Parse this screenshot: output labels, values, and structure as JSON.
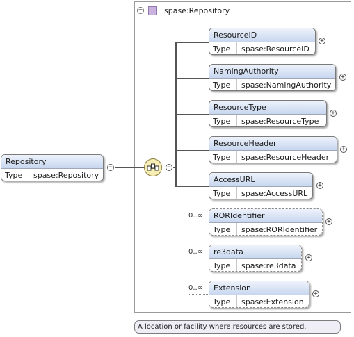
{
  "container": {
    "title": "spase:Repository",
    "collapse_symbol": "−"
  },
  "root": {
    "name": "Repository",
    "type_label": "Type",
    "type_value": "spase:Repository"
  },
  "elements": [
    {
      "name": "ResourceID",
      "type_label": "Type",
      "type_value": "spase:ResourceID",
      "occurs": ""
    },
    {
      "name": "NamingAuthority",
      "type_label": "Type",
      "type_value": "spase:NamingAuthority",
      "occurs": ""
    },
    {
      "name": "ResourceType",
      "type_label": "Type",
      "type_value": "spase:ResourceType",
      "occurs": ""
    },
    {
      "name": "ResourceHeader",
      "type_label": "Type",
      "type_value": "spase:ResourceHeader",
      "occurs": ""
    },
    {
      "name": "AccessURL",
      "type_label": "Type",
      "type_value": "spase:AccessURL",
      "occurs": ""
    },
    {
      "name": "RORIdentifier",
      "type_label": "Type",
      "type_value": "spase:RORIdentifier",
      "occurs": "0..∞"
    },
    {
      "name": "re3data",
      "type_label": "Type",
      "type_value": "spase:re3data",
      "occurs": "0..∞"
    },
    {
      "name": "Extension",
      "type_label": "Type",
      "type_value": "spase:Extension",
      "occurs": "0..∞"
    }
  ],
  "symbols": {
    "expand": "+",
    "collapse": "−"
  },
  "tooltip": "A location or facility where resources are stored."
}
